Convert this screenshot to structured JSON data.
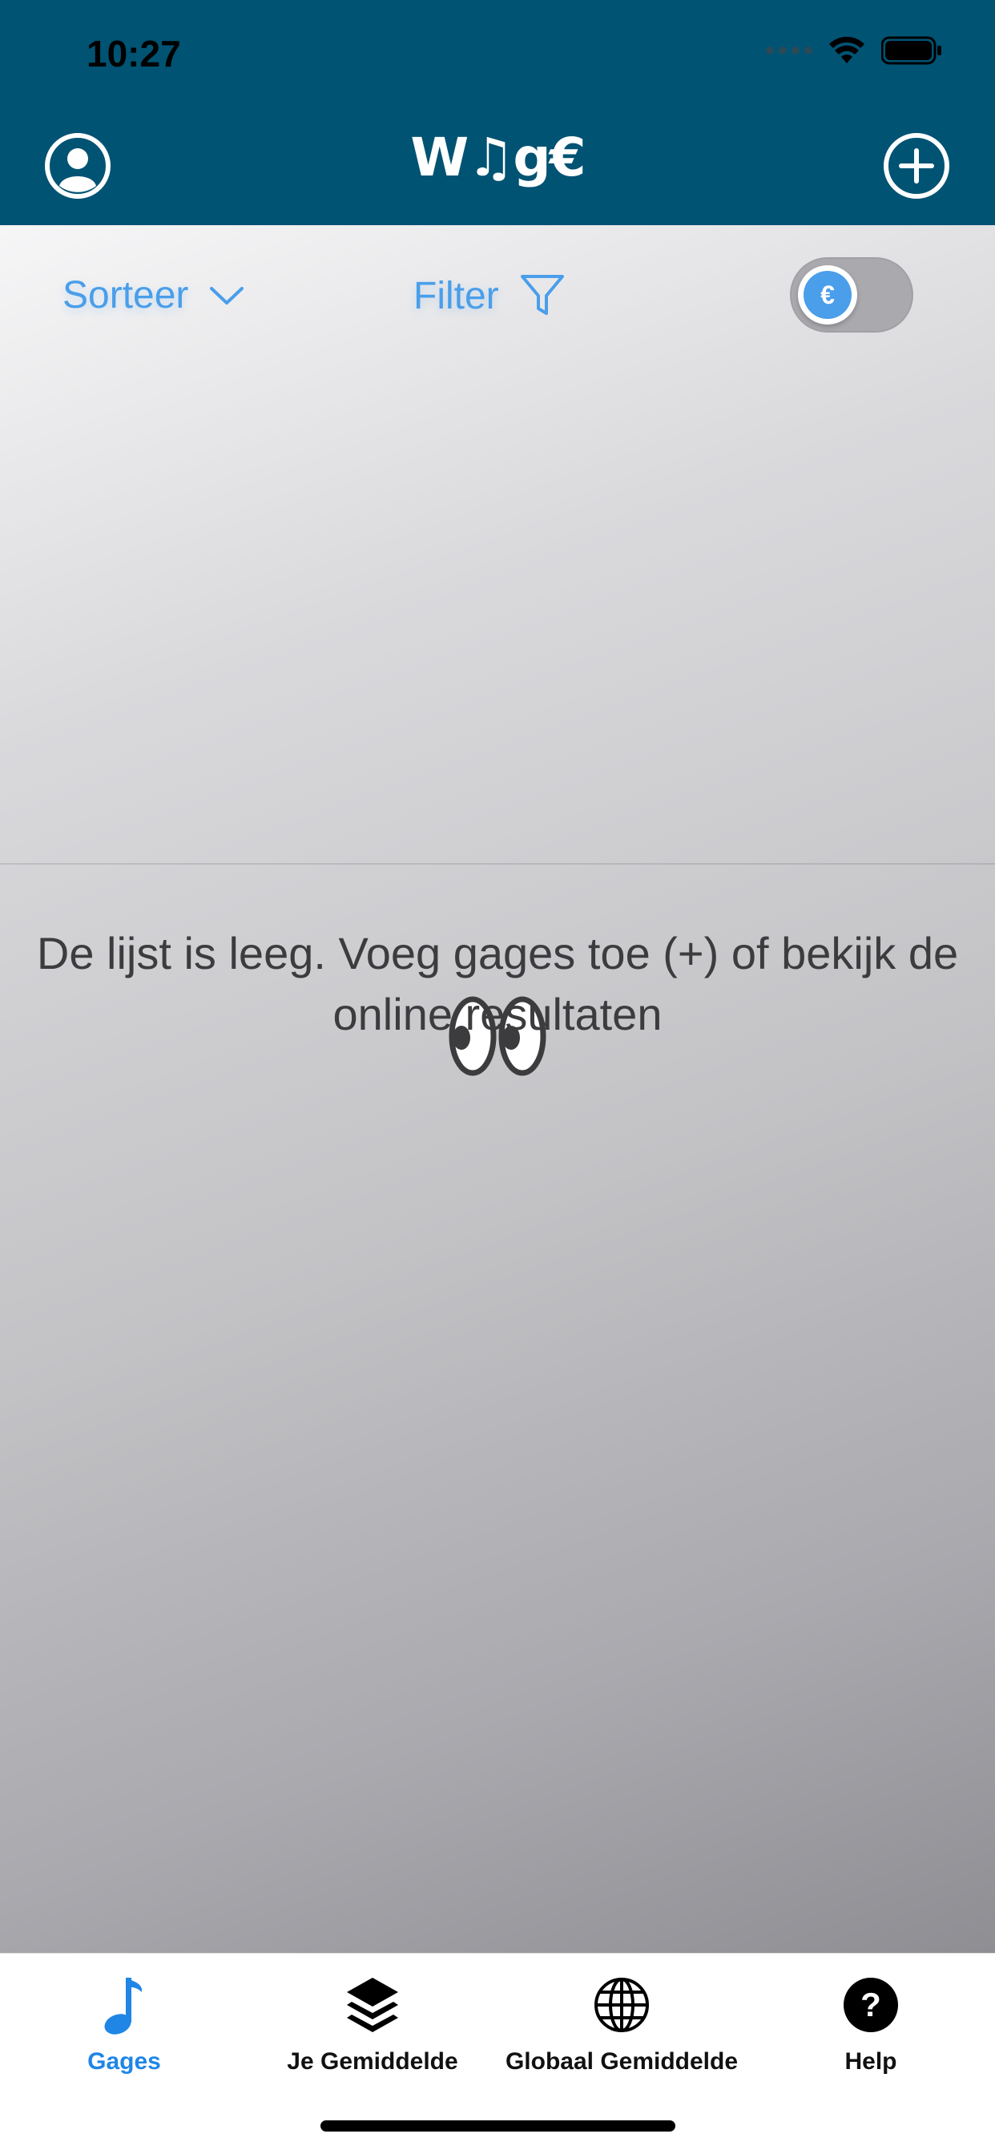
{
  "status_bar": {
    "time": "10:27"
  },
  "header": {
    "logo_text": "W♫g€",
    "left_icon": "account-icon",
    "right_icon": "add-circle-icon"
  },
  "toolbar": {
    "sort_label": "Sorteer",
    "filter_label": "Filter",
    "currency_toggle_symbol": "€"
  },
  "empty_state": {
    "icon": "eyes-icon",
    "message": "De lijst is leeg. Voeg gages toe (+) of bekijk de online resultaten"
  },
  "tabs": [
    {
      "label": "Gages",
      "icon": "music-note-icon",
      "active": true
    },
    {
      "label": "Je Gemiddelde",
      "icon": "layers-icon",
      "active": false
    },
    {
      "label": "Globaal Gemiddelde",
      "icon": "globe-icon",
      "active": false
    },
    {
      "label": "Help",
      "icon": "help-icon",
      "active": false
    }
  ],
  "colors": {
    "header": "#005373",
    "accent": "#4A9EEA",
    "tab_active": "#1F86E6"
  }
}
